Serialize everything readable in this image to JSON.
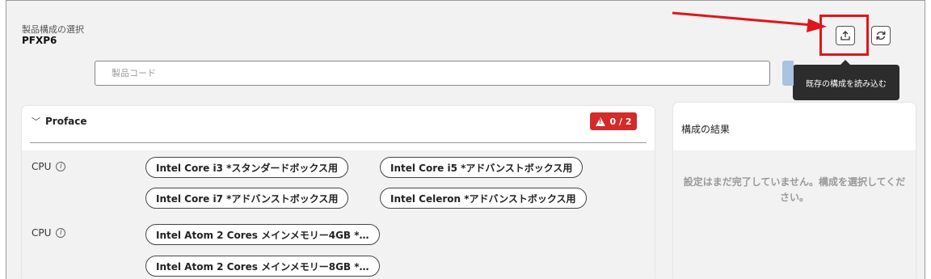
{
  "header": {
    "subtitle": "製品構成の選択",
    "product_code": "PFXP6"
  },
  "toolbar": {
    "upload_icon": "upload-icon",
    "refresh_icon": "refresh-icon",
    "tooltip": "既存の構成を読み込む"
  },
  "search": {
    "placeholder": "製品コード",
    "value": ""
  },
  "annotation": {
    "highlight_color": "#e0161a"
  },
  "panel": {
    "title": "Proface",
    "badge": "0 / 2",
    "badge_color": "#d32a2a",
    "groups": [
      {
        "label": "CPU",
        "options": [
          "Intel Core i3 *スタンダードボックス用",
          "Intel Core i5 *アドバンストボックス用",
          "Intel Core i7 *アドバンストボックス用",
          "Intel Celeron *アドバンストボックス用"
        ]
      },
      {
        "label": "CPU",
        "options": [
          "Intel Atom 2 Cores メインメモリー4GB *…",
          "Intel Atom 2 Cores メインメモリー8GB *…"
        ]
      }
    ]
  },
  "result": {
    "title": "構成の結果",
    "message": "設定はまだ完了していません。構成を選択してください。"
  }
}
